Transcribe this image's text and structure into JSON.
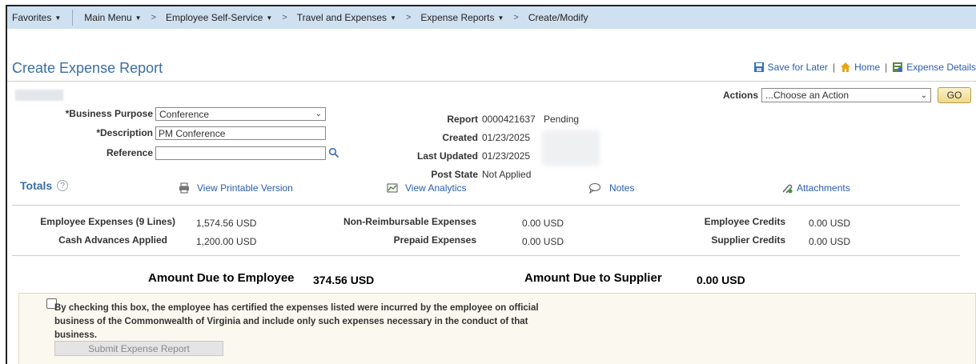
{
  "nav": {
    "favorites": "Favorites",
    "main_menu": "Main Menu",
    "breadcrumbs": [
      "Employee Self-Service",
      "Travel and Expenses",
      "Expense Reports",
      "Create/Modify"
    ]
  },
  "page": {
    "title": "Create Expense Report",
    "links": {
      "save_for_later": "Save for Later",
      "home": "Home",
      "expense_details": "Expense Details"
    }
  },
  "actions": {
    "label": "Actions",
    "selected": "...Choose an Action",
    "go": "GO"
  },
  "form": {
    "business_purpose_label": "*Business Purpose",
    "business_purpose_value": "Conference",
    "description_label": "*Description",
    "description_value": "PM Conference",
    "reference_label": "Reference",
    "reference_value": ""
  },
  "report_info": {
    "report_label": "Report",
    "report_number": "0000421637",
    "report_status": "Pending",
    "created_label": "Created",
    "created_value": "01/23/2025",
    "last_updated_label": "Last Updated",
    "last_updated_value": "01/23/2025",
    "post_state_label": "Post State",
    "post_state_value": "Not Applied"
  },
  "totals": {
    "title": "Totals",
    "help": "?",
    "links": {
      "printable": "View Printable Version",
      "analytics": "View Analytics",
      "notes": "Notes",
      "attachments": "Attachments"
    },
    "employee_expenses_label": "Employee Expenses (9 Lines)",
    "employee_expenses_value": "1,574.56  USD",
    "cash_advances_label": "Cash Advances Applied",
    "cash_advances_value": "1,200.00  USD",
    "non_reimbursable_label": "Non-Reimbursable Expenses",
    "non_reimbursable_value": "0.00  USD",
    "prepaid_label": "Prepaid Expenses",
    "prepaid_value": "0.00  USD",
    "employee_credits_label": "Employee Credits",
    "employee_credits_value": "0.00  USD",
    "supplier_credits_label": "Supplier Credits",
    "supplier_credits_value": "0.00  USD"
  },
  "due": {
    "employee_label": "Amount Due to Employee",
    "employee_value": "374.56  USD",
    "supplier_label": "Amount Due to Supplier",
    "supplier_value": "0.00  USD"
  },
  "certification": {
    "text": "By checking this box, the employee has certified the expenses listed were incurred by the employee on official business of the Commonwealth of Virginia and include only such expenses necessary in the conduct of that business.",
    "submit": "Submit Expense Report"
  }
}
